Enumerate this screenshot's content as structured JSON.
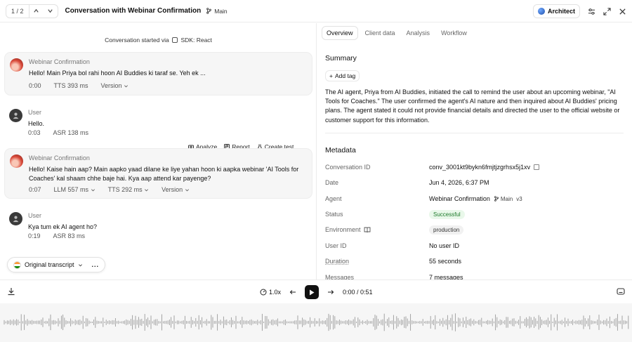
{
  "topbar": {
    "pager": "1 / 2",
    "title": "Conversation with Webinar Confirmation",
    "branch": "Main",
    "architect": "Architect"
  },
  "left": {
    "started": "Conversation started via",
    "sdk": "SDK: React",
    "messages": [
      {
        "speaker": "Webinar Confirmation",
        "text": "Hello! Main Priya bol rahi hoon AI Buddies ki taraf se. Yeh ek ...",
        "time": "0:00",
        "m1": "TTS 393 ms",
        "m2": "Version"
      },
      {
        "speaker": "User",
        "text": "Hello.",
        "time": "0:03",
        "m1": "ASR 138 ms"
      },
      {
        "speaker": "Webinar Confirmation",
        "text": "Hello! Kaise hain aap? Main aapko yaad dilane ke liye yahan hoon ki aapka webinar 'AI Tools for Coaches' kal shaam chhe baje hai. Kya aap attend kar payenge?",
        "time": "0:07",
        "m1": "LLM 557 ms",
        "m2": "TTS 292 ms",
        "m3": "Version"
      },
      {
        "speaker": "User",
        "text": "Kya tum ek AI agent ho?",
        "time": "0:19",
        "m1": "ASR 83 ms"
      }
    ],
    "actions": {
      "analyze": "Analyze",
      "report": "Report",
      "create_test": "Create test"
    },
    "original_transcript": "Original transcript",
    "more": "..."
  },
  "right": {
    "tabs": [
      "Overview",
      "Client data",
      "Analysis",
      "Workflow"
    ],
    "summary_title": "Summary",
    "add_tag": "Add tag",
    "summary": "The AI agent, Priya from AI Buddies, initiated the call to remind the user about an upcoming webinar, \"AI Tools for Coaches.\" The user confirmed the agent's AI nature and then inquired about AI Buddies' pricing plans. The agent stated it could not provide financial details and directed the user to the official website or customer support for this information.",
    "metadata_title": "Metadata",
    "metadata": {
      "conversation_id_label": "Conversation ID",
      "conversation_id": "conv_3001kt9bykn6fmjtjzgrhsx5j1xv",
      "date_label": "Date",
      "date": "Jun 4, 2026, 6:37 PM",
      "agent_label": "Agent",
      "agent": "Webinar Confirmation",
      "agent_branch": "Main",
      "agent_version": "v3",
      "status_label": "Status",
      "status": "Successful",
      "environment_label": "Environment",
      "environment": "production",
      "user_id_label": "User ID",
      "user_id": "No user ID",
      "duration_label": "Duration",
      "duration": "55 seconds",
      "messages_label": "Messages",
      "messages": "7 messages"
    }
  },
  "player": {
    "speed": "1.0x",
    "time": "0:00 / 0:51"
  },
  "colors": {
    "success_bg": "#e9f8ea",
    "success_text": "#1d7a2a",
    "play": "#111111"
  }
}
